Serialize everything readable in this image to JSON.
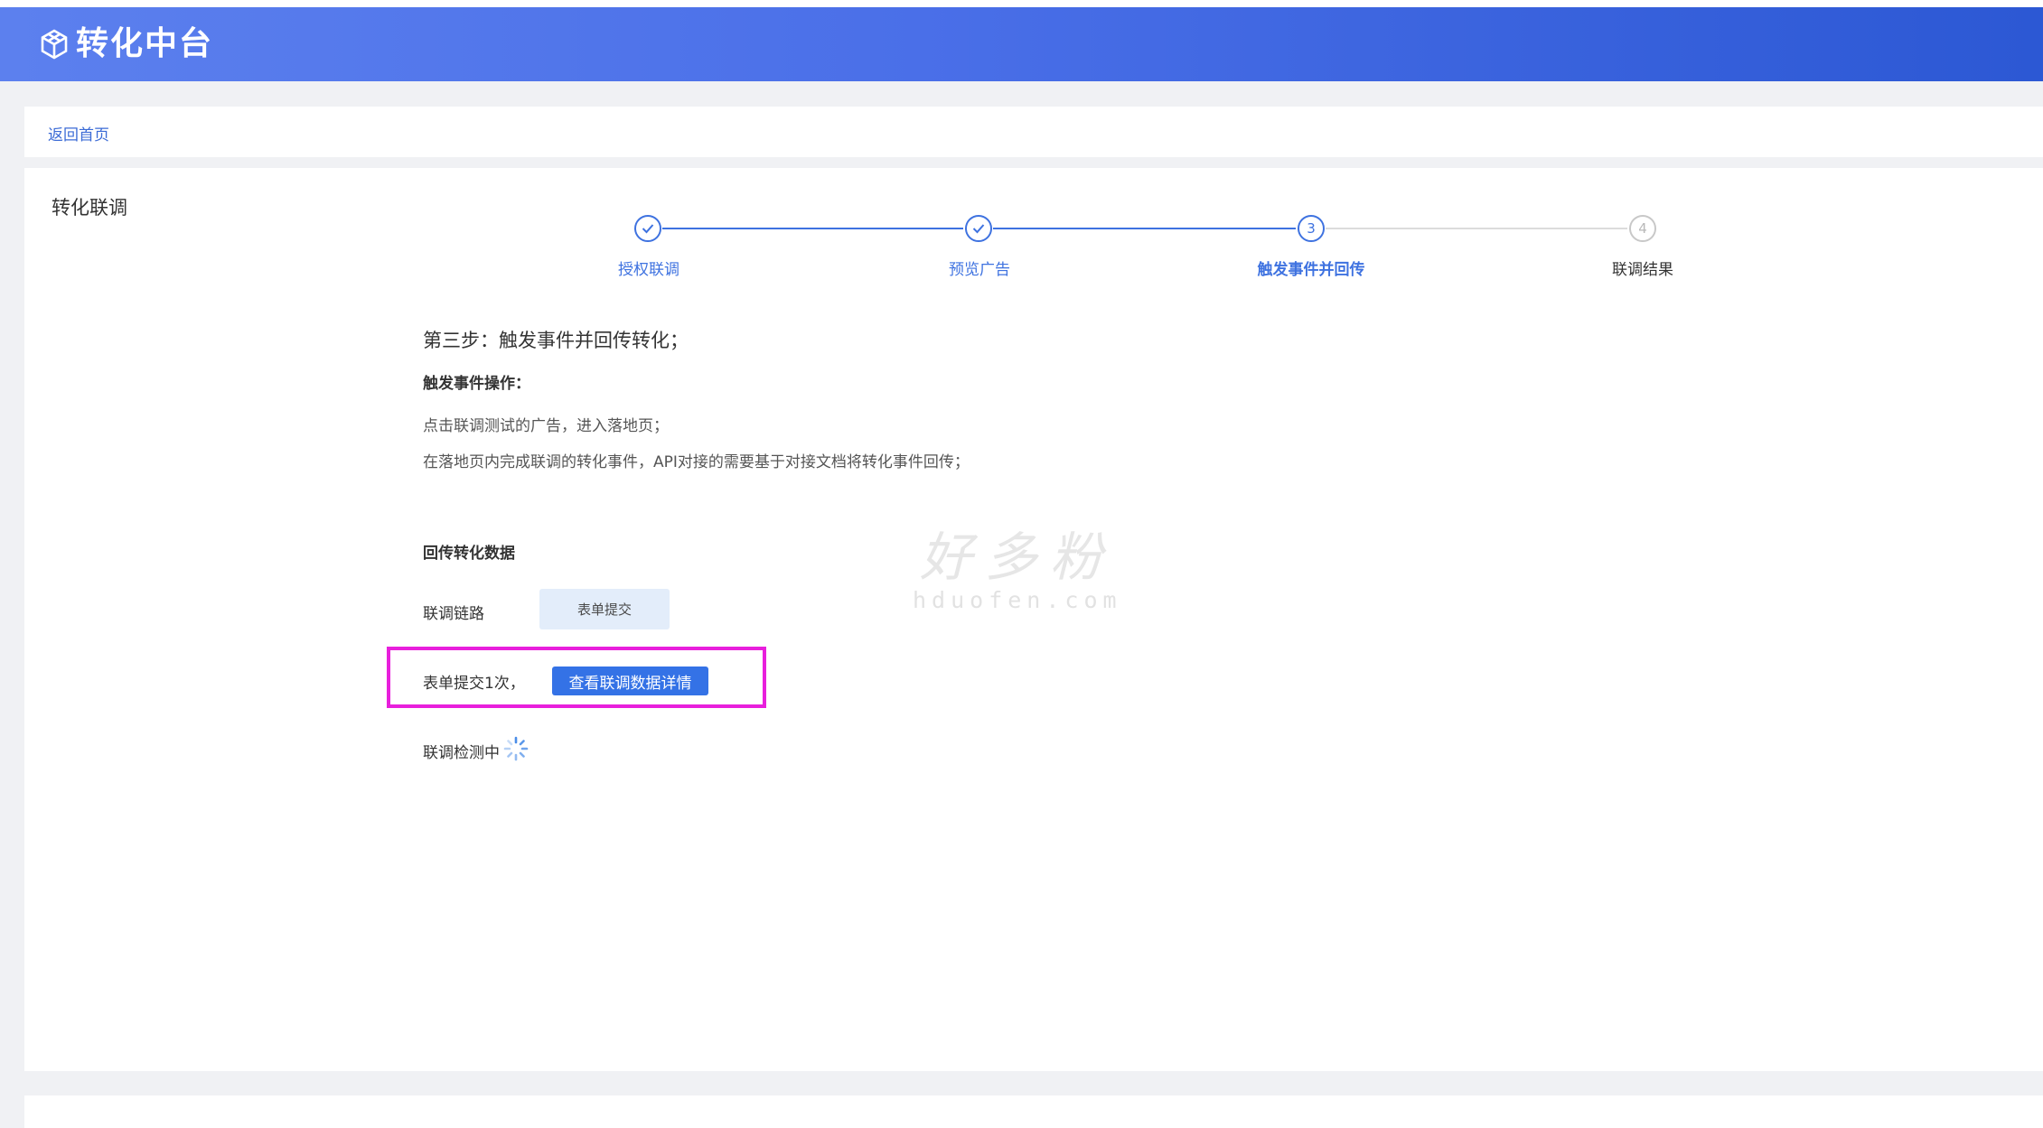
{
  "app": {
    "title": "转化中台",
    "logo_icon": "hexagon-cube-icon"
  },
  "nav": {
    "back_label": "返回首页"
  },
  "panel": {
    "title": "转化联调"
  },
  "steps": [
    {
      "label": "授权联调",
      "status": "done",
      "marker": "✓"
    },
    {
      "label": "预览广告",
      "status": "done",
      "marker": "✓"
    },
    {
      "label": "触发事件并回传",
      "status": "active",
      "marker": "3"
    },
    {
      "label": "联调结果",
      "status": "todo",
      "marker": "4"
    }
  ],
  "content": {
    "heading": "第三步：触发事件并回传转化；",
    "sub_heading": "触发事件操作：",
    "instructions": [
      "点击联调测试的广告，进入落地页；",
      "在落地页内完成联调的转化事件，API对接的需要基于对接文档将转化事件回传；"
    ],
    "section_title": "回传转化数据",
    "chain_label": "联调链路",
    "chain_tag": "表单提交",
    "submit_status": "表单提交1次，",
    "detail_button": "查看联调数据详情",
    "checking_label": "联调检测中"
  },
  "watermark": {
    "cn": "好多粉",
    "en": "hduofen.com"
  },
  "colors": {
    "primary": "#3e72e0",
    "header_start": "#5c80ee",
    "header_end": "#2c58d4",
    "highlight": "#e81fdc"
  }
}
